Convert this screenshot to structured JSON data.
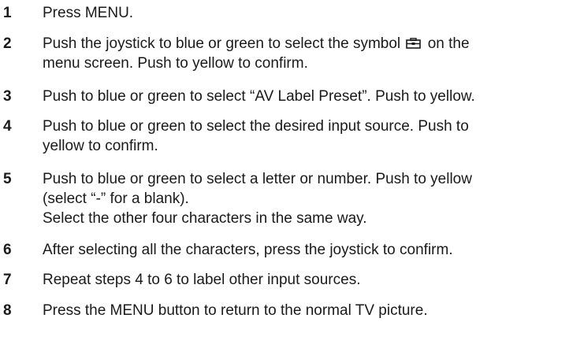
{
  "steps": [
    {
      "num": "1",
      "lines": [
        "Press MENU."
      ]
    },
    {
      "num": "2",
      "lines": [
        "Push the joystick to blue or green to select the symbol",
        "on the",
        "menu screen.  Push to yellow to confirm."
      ]
    },
    {
      "num": "3",
      "lines": [
        "Push to blue or green to select “AV Label Preset”.  Push to yellow."
      ]
    },
    {
      "num": "4",
      "lines": [
        "Push to blue or green to select the desired input source.  Push to",
        "yellow to confirm."
      ]
    },
    {
      "num": "5",
      "lines": [
        "Push to blue or green to select a letter or number.  Push to yellow",
        "(select “-” for a blank).",
        "Select the other four characters in the same way."
      ]
    },
    {
      "num": "6",
      "lines": [
        "After selecting all the characters, press the joystick to confirm."
      ]
    },
    {
      "num": "7",
      "lines": [
        "Repeat steps 4 to 6 to label other input sources."
      ]
    },
    {
      "num": "8",
      "lines": [
        "Press the MENU button to return to the normal TV picture."
      ]
    }
  ],
  "icons": {
    "setup_symbol": "toolbox-icon"
  }
}
